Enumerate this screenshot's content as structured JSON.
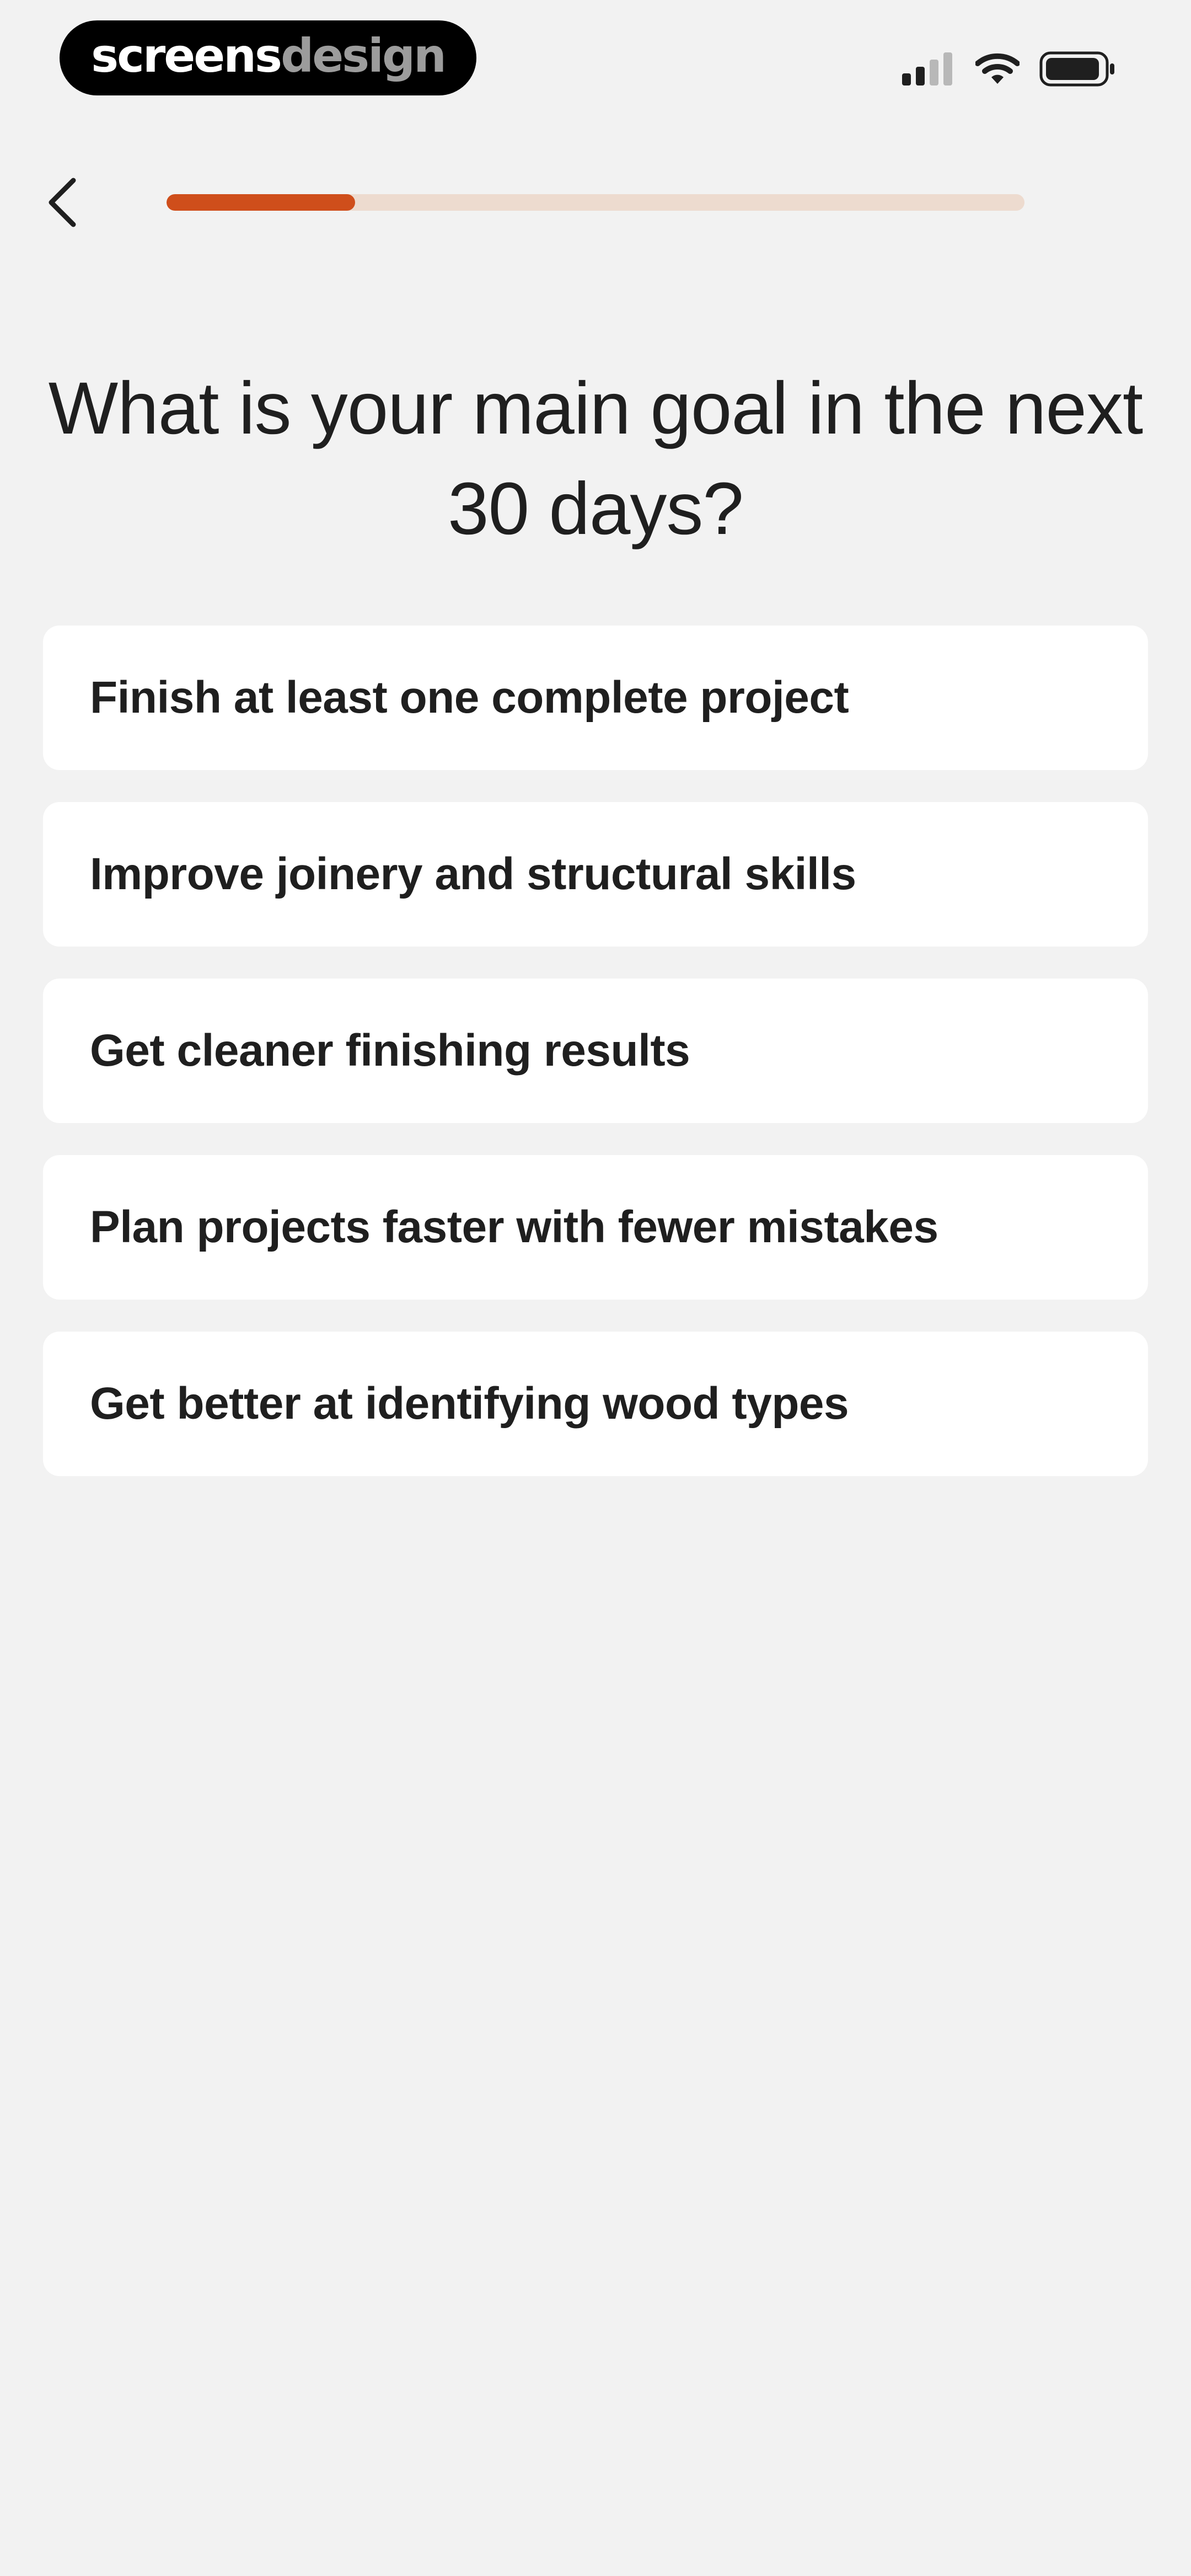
{
  "status_bar": {
    "logo": {
      "part1": "screens",
      "part2": "design"
    }
  },
  "onboarding": {
    "progress_fraction": 0.22,
    "colors": {
      "accent": "#cf4e1b",
      "track": "#eddbcf",
      "background": "#f2f2f2",
      "card": "#ffffff"
    },
    "question": "What is your main goal in the next 30 days?",
    "options": [
      {
        "label": "Finish at least one complete project"
      },
      {
        "label": "Improve joinery and structural skills"
      },
      {
        "label": "Get cleaner finishing results"
      },
      {
        "label": "Plan projects faster with fewer mistakes"
      },
      {
        "label": "Get better at identifying wood types"
      }
    ]
  },
  "icons": {
    "back": "chevron-left-icon",
    "signal": "cellular-signal-icon",
    "wifi": "wifi-icon",
    "battery": "battery-icon"
  }
}
